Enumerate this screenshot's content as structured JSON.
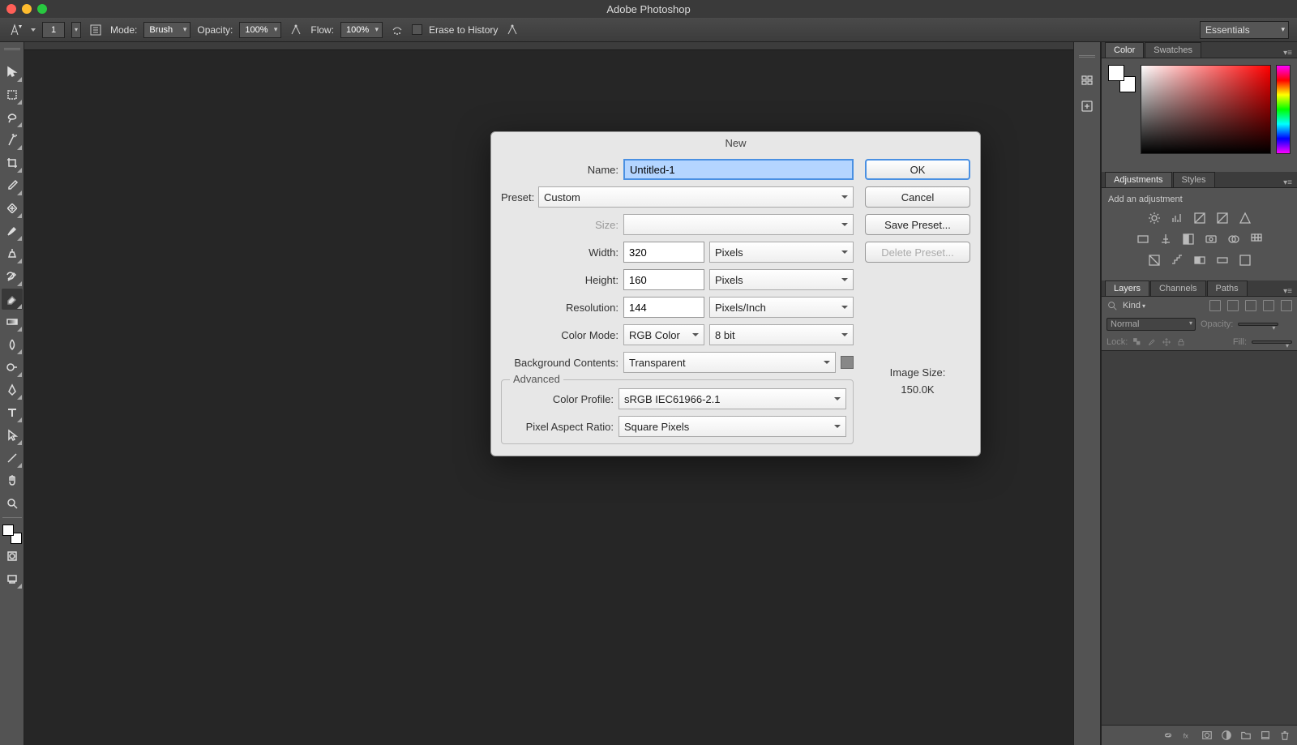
{
  "app": {
    "title": "Adobe Photoshop"
  },
  "workspace_selector": "Essentials",
  "options_bar": {
    "size_value": "1",
    "mode_label": "Mode:",
    "mode_value": "Brush",
    "opacity_label": "Opacity:",
    "opacity_value": "100%",
    "flow_label": "Flow:",
    "flow_value": "100%",
    "erase_history_label": "Erase to History"
  },
  "dialog": {
    "title": "New",
    "name_label": "Name:",
    "name_value": "Untitled-1",
    "preset_label": "Preset:",
    "preset_value": "Custom",
    "size_label": "Size:",
    "width_label": "Width:",
    "width_value": "320",
    "width_unit": "Pixels",
    "height_label": "Height:",
    "height_value": "160",
    "height_unit": "Pixels",
    "resolution_label": "Resolution:",
    "resolution_value": "144",
    "resolution_unit": "Pixels/Inch",
    "color_mode_label": "Color Mode:",
    "color_mode_value": "RGB Color",
    "bit_depth_value": "8 bit",
    "bg_label": "Background Contents:",
    "bg_value": "Transparent",
    "advanced_label": "Advanced",
    "color_profile_label": "Color Profile:",
    "color_profile_value": "sRGB IEC61966-2.1",
    "pixel_aspect_label": "Pixel Aspect Ratio:",
    "pixel_aspect_value": "Square Pixels",
    "ok_label": "OK",
    "cancel_label": "Cancel",
    "save_preset_label": "Save Preset...",
    "delete_preset_label": "Delete Preset...",
    "image_size_label": "Image Size:",
    "image_size_value": "150.0K"
  },
  "panels": {
    "color_tab": "Color",
    "swatches_tab": "Swatches",
    "adjustments_tab": "Adjustments",
    "styles_tab": "Styles",
    "add_adjustment_label": "Add an adjustment",
    "layers_tab": "Layers",
    "channels_tab": "Channels",
    "paths_tab": "Paths",
    "kind_label": "Kind",
    "blend_mode": "Normal",
    "opacity_label": "Opacity:",
    "lock_label": "Lock:",
    "fill_label": "Fill:"
  }
}
